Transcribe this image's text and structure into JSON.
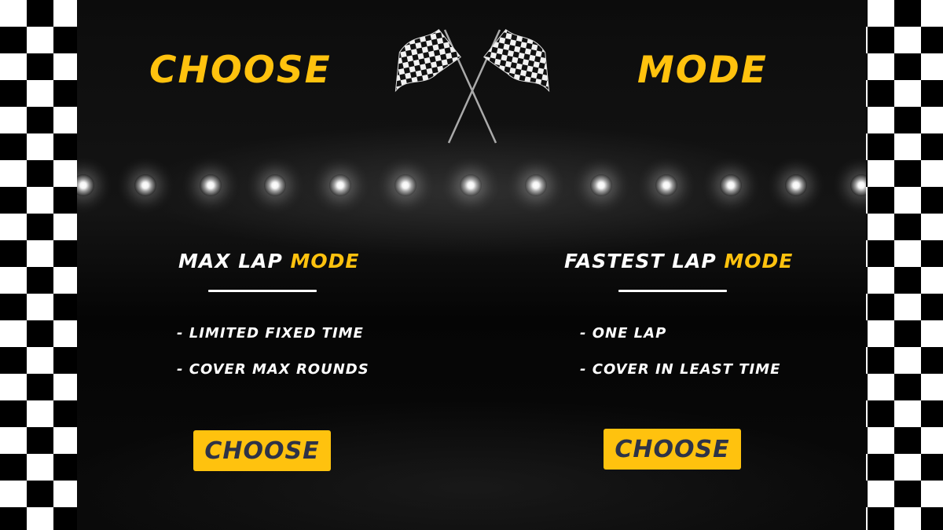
{
  "header": {
    "left_word": "CHOOSE",
    "right_word": "MODE",
    "center_icon": "crossed-checkered-flags-icon"
  },
  "modes": [
    {
      "title_main": "MAX LAP ",
      "title_accent": "MODE",
      "bullets": [
        "- LIMITED FIXED TIME",
        "- COVER MAX ROUNDS"
      ],
      "button_label": "CHOOSE"
    },
    {
      "title_main": "FASTEST LAP ",
      "title_accent": "MODE",
      "bullets": [
        "- ONE LAP",
        "- COVER IN LEAST TIME"
      ],
      "button_label": "CHOOSE"
    }
  ],
  "colors": {
    "accent": "#FFC20E",
    "button_text": "#2E3347",
    "background": "#000000",
    "text": "#FFFFFF"
  },
  "decor": {
    "border_pattern": "checkered-border",
    "light_icon": "spotlight-icon"
  }
}
